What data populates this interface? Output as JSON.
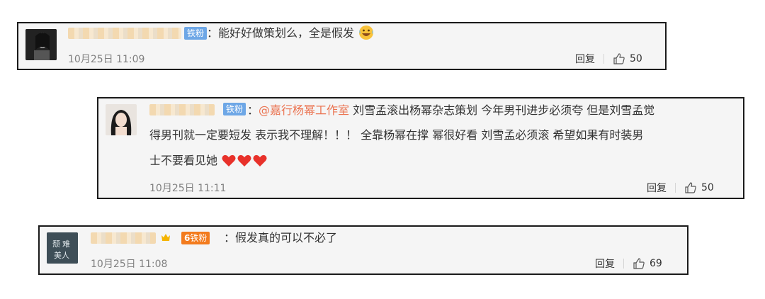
{
  "comments": [
    {
      "badge": "铁粉",
      "colon": "：",
      "text": "能好好做策划么，全是假发",
      "emoji": "grin-sweat-emoji",
      "time": "10月25日 11:09",
      "reply": "回复",
      "likes": "50"
    },
    {
      "badge": "铁粉",
      "colon": "：",
      "mention": "@嘉行杨幂工作室",
      "line1": " 刘雪孟滚出杨幂杂志策划 今年男刊进步必须夸 但是刘雪孟觉",
      "line2": "得男刊就一定要短发 表示我不理解！！！ 全靠杨幂在撑 幂很好看 刘雪孟必须滚 希望如果有时装男",
      "line3": "士不要看见她",
      "hearts": 3,
      "time": "10月25日 11:11",
      "reply": "回复",
      "likes": "50"
    },
    {
      "badge": "铁粉",
      "badge_prefix": "6",
      "colon": "：",
      "text": "假发真的可以不必了",
      "avatar_text": "颓难\n美人",
      "time": "10月25日 11:08",
      "reply": "回复",
      "likes": "69"
    }
  ],
  "colors": {
    "badge_blue": "#6ea7e6",
    "badge_orange": "#f37b1d",
    "mention": "#eb7350",
    "heart": "#e8312a"
  }
}
